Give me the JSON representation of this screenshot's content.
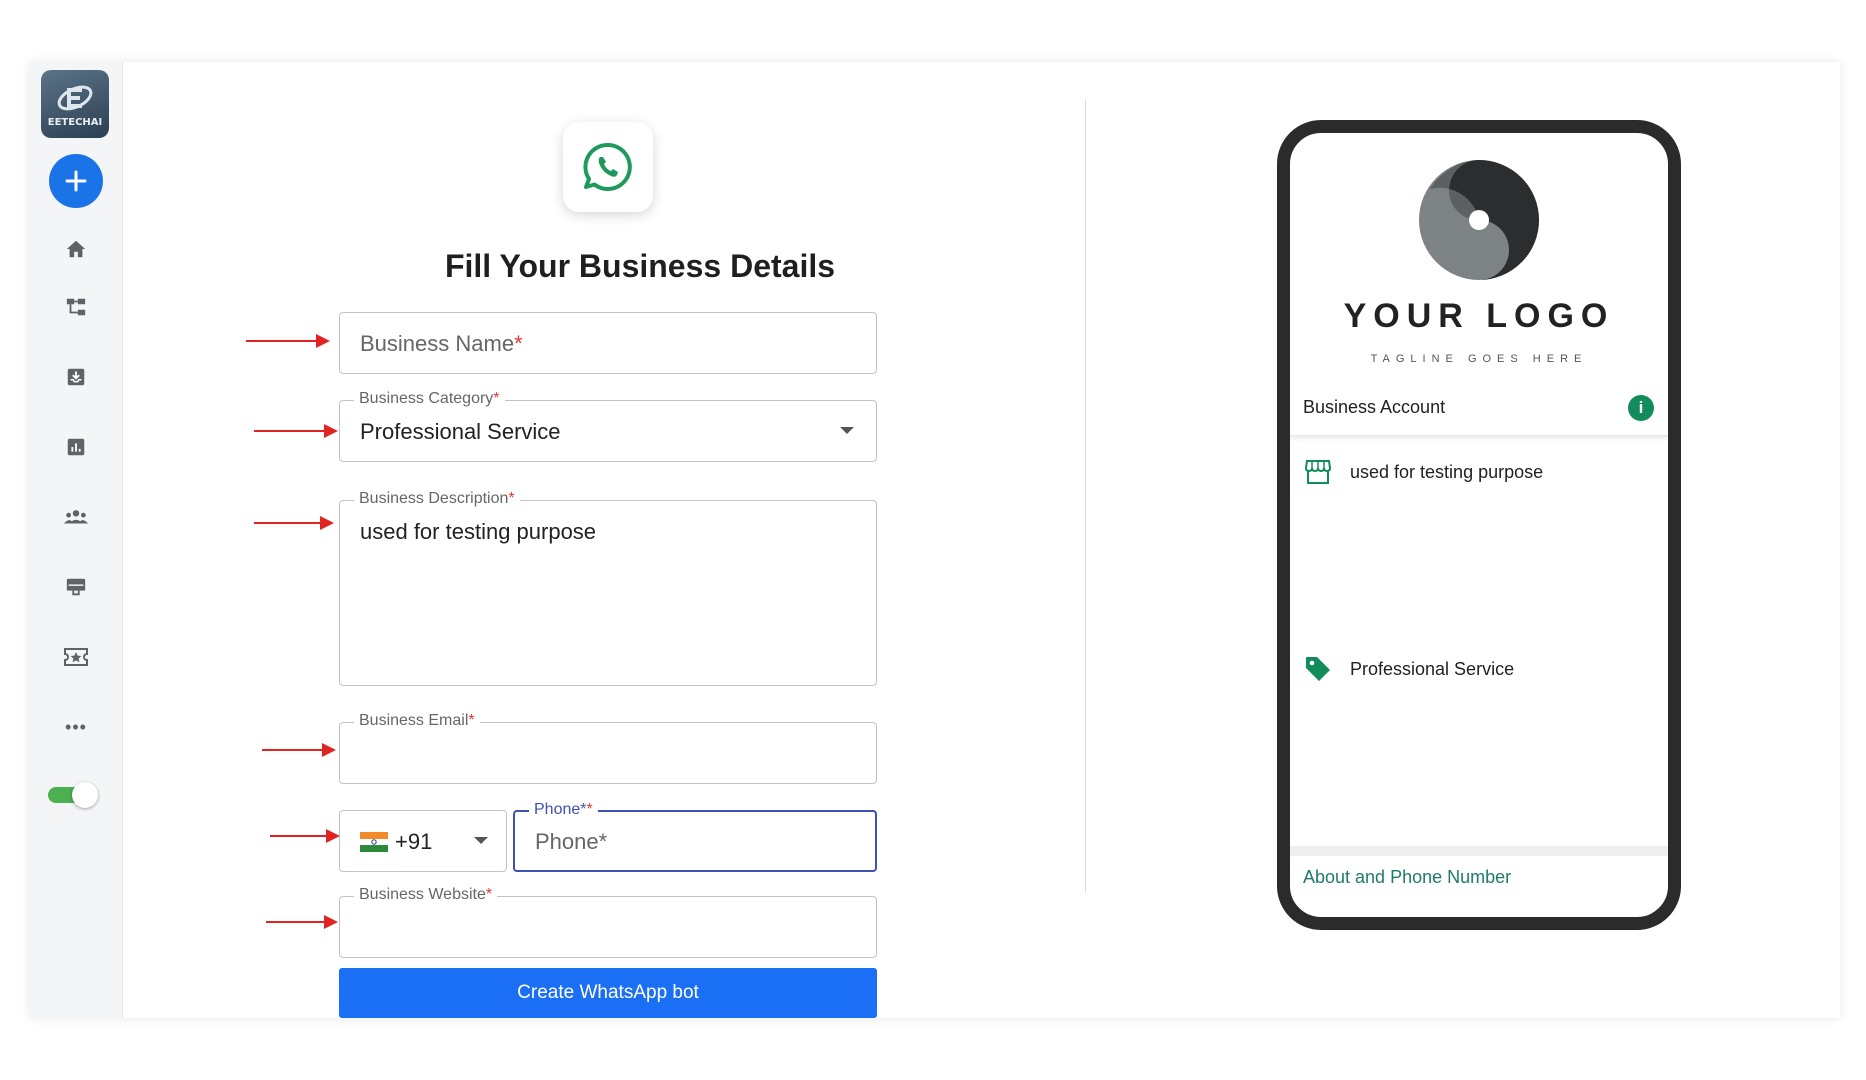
{
  "sidebar": {
    "logo_text": "EETECHAI",
    "add_label": "+",
    "more_label": "•••",
    "nav": [
      "home",
      "flows",
      "inbox",
      "analytics",
      "contacts",
      "templates",
      "campaigns"
    ]
  },
  "form": {
    "title": "Fill Your Business Details",
    "business_name": {
      "placeholder": "Business Name",
      "required_mark": "*"
    },
    "business_category": {
      "label": "Business Category",
      "required_mark": "*",
      "value": "Professional Service"
    },
    "business_description": {
      "label": "Business Description",
      "required_mark": "*",
      "value": "used for testing purpose"
    },
    "business_email": {
      "label": "Business Email",
      "required_mark": "*",
      "value": ""
    },
    "phone": {
      "country_code": "+91",
      "label": "Phone*",
      "required_mark": "*",
      "placeholder": "Phone*"
    },
    "business_website": {
      "label": "Business Website",
      "required_mark": "*",
      "value": ""
    },
    "submit_label": "Create WhatsApp bot"
  },
  "preview": {
    "logo_title": "YOUR LOGO",
    "tagline": "TAGLINE GOES HERE",
    "account_label": "Business Account",
    "info_glyph": "i",
    "description": "used for testing purpose",
    "category": "Professional Service",
    "about_link": "About and Phone Number"
  },
  "colors": {
    "primary": "#1b6ff5",
    "whatsapp_green": "#1f9a5c",
    "annotation_red": "#e02424",
    "focus_blue": "#3f51b5",
    "toggle_green": "#4caf50"
  }
}
